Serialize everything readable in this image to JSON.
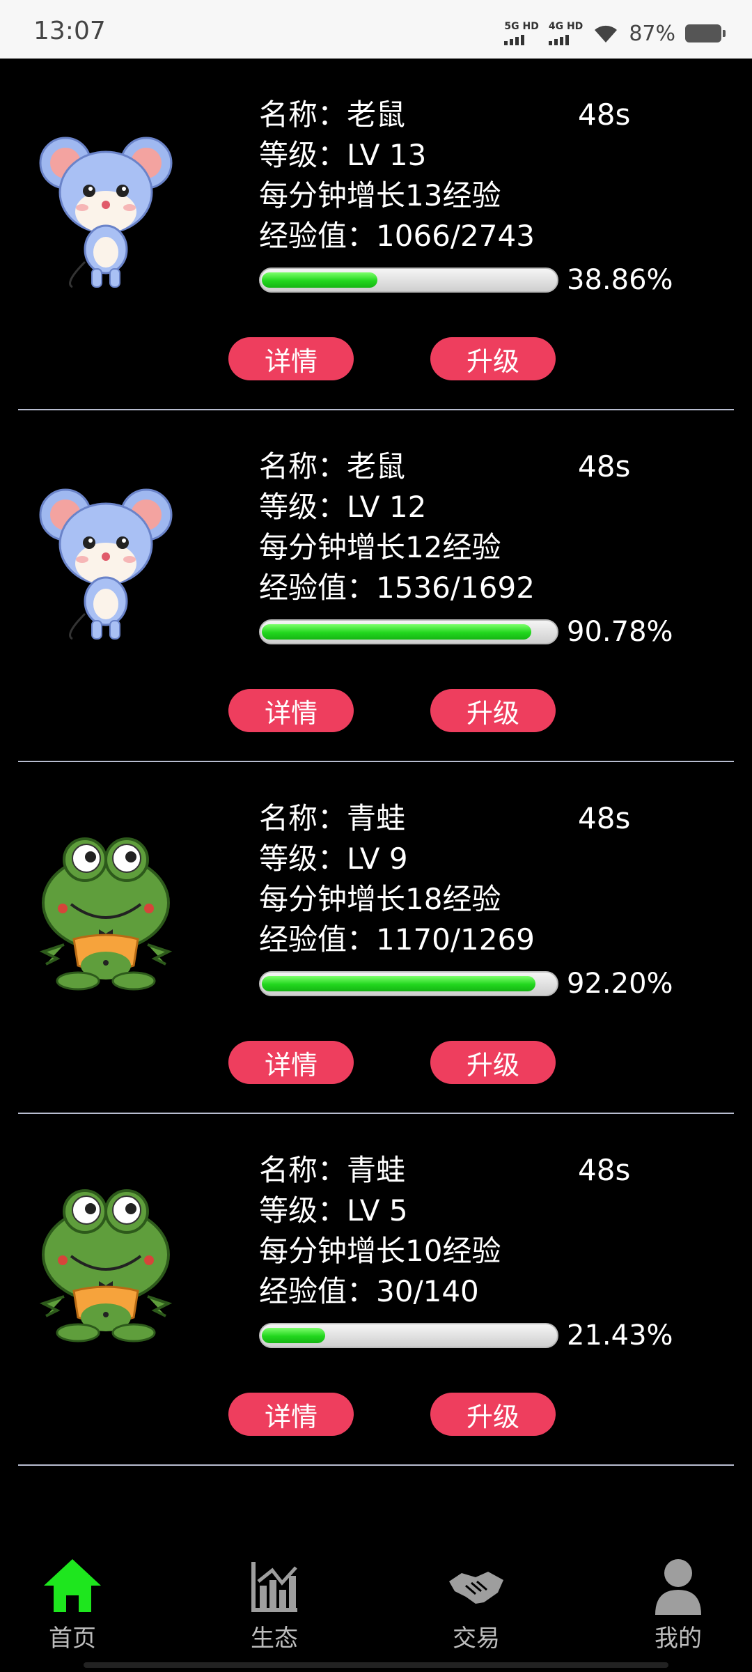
{
  "status_bar": {
    "time": "13:07",
    "sim1": "5G HD",
    "sim2": "4G HD",
    "battery": "87%"
  },
  "cards": [
    {
      "animal_icon": "mouse-icon",
      "name_label": "名称：",
      "name": "老鼠",
      "timer": "48s",
      "level_label": "等级：",
      "level": "LV 13",
      "growth": "每分钟增长13经验",
      "exp_label": "经验值：",
      "exp": "1066/2743",
      "progress_text": "38.86%",
      "progress": 0.3886,
      "detail_label": "详情",
      "upgrade_label": "升级"
    },
    {
      "animal_icon": "mouse-icon",
      "name_label": "名称：",
      "name": "老鼠",
      "timer": "48s",
      "level_label": "等级：",
      "level": "LV 12",
      "growth": "每分钟增长12经验",
      "exp_label": "经验值：",
      "exp": "1536/1692",
      "progress_text": "90.78%",
      "progress": 0.9078,
      "detail_label": "详情",
      "upgrade_label": "升级"
    },
    {
      "animal_icon": "frog-icon",
      "name_label": "名称：",
      "name": "青蛙",
      "timer": "48s",
      "level_label": "等级：",
      "level": "LV 9",
      "growth": "每分钟增长18经验",
      "exp_label": "经验值：",
      "exp": "1170/1269",
      "progress_text": "92.20%",
      "progress": 0.922,
      "detail_label": "详情",
      "upgrade_label": "升级"
    },
    {
      "animal_icon": "frog-icon",
      "name_label": "名称：",
      "name": "青蛙",
      "timer": "48s",
      "level_label": "等级：",
      "level": "LV 5",
      "growth": "每分钟增长10经验",
      "exp_label": "经验值：",
      "exp": "30/140",
      "progress_text": "21.43%",
      "progress": 0.2143,
      "detail_label": "详情",
      "upgrade_label": "升级"
    }
  ],
  "tabbar": {
    "tabs": [
      {
        "label": "首页",
        "icon": "home-icon",
        "active": true
      },
      {
        "label": "生态",
        "icon": "chart-icon",
        "active": false
      },
      {
        "label": "交易",
        "icon": "handshake-icon",
        "active": false
      },
      {
        "label": "我的",
        "icon": "user-icon",
        "active": false
      }
    ]
  },
  "colors": {
    "button": "#ee3e5e",
    "progress_fill": "#22d61e",
    "active_tab_icon": "#1ee61e",
    "inactive_tab_icon": "#9e9e9e"
  }
}
